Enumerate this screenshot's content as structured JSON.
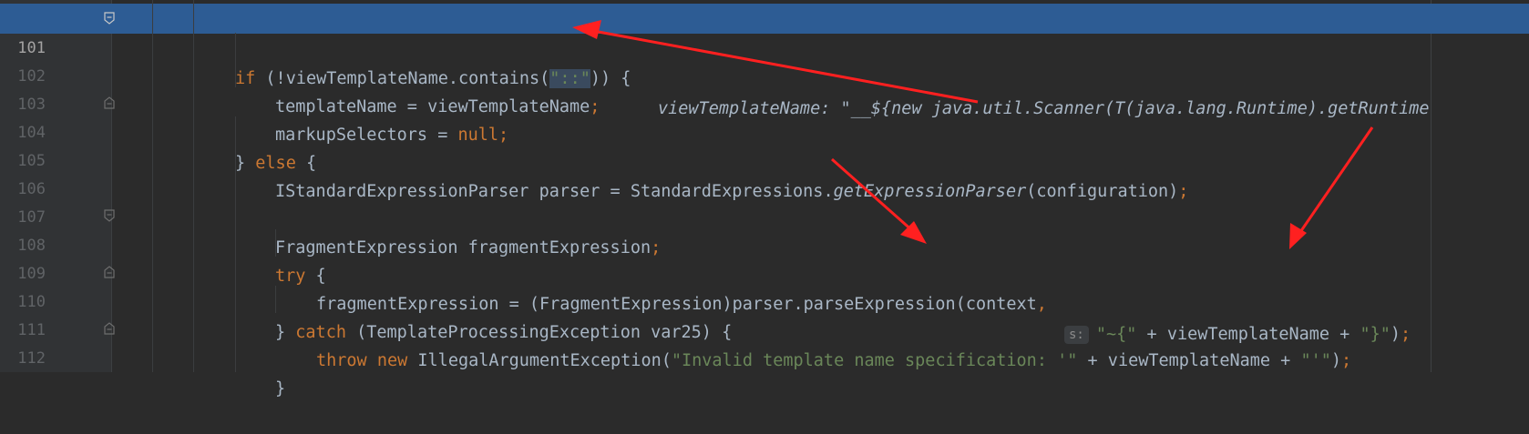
{
  "editor": {
    "lines": [
      {
        "num": "101",
        "current": true
      },
      {
        "num": "102"
      },
      {
        "num": "103"
      },
      {
        "num": "104"
      },
      {
        "num": "105"
      },
      {
        "num": "106"
      },
      {
        "num": "107"
      },
      {
        "num": "108"
      },
      {
        "num": "109"
      },
      {
        "num": "110"
      },
      {
        "num": "111"
      },
      {
        "num": "112"
      }
    ],
    "code": {
      "l101_kw": "if",
      "l101_a": " (!viewTemplateName.contains(",
      "l101_str": "\"::\"",
      "l101_b": ")) {",
      "l101_hint": "viewTemplateName: \"__${new java.util.Scanner(T(java.lang.Runtime).getRuntime",
      "l102_a": "templateName = viewTemplateName",
      "l102_semi": ";",
      "l103_a": "markupSelectors = ",
      "l103_kw": "null",
      "l103_semi": ";",
      "l104_a": "} ",
      "l104_kw": "else",
      "l104_b": " {",
      "l105_a": "IStandardExpressionParser parser = StandardExpressions.",
      "l105_it": "getExpressionParser",
      "l105_b": "(configuration)",
      "l105_semi": ";",
      "l107_a": "FragmentExpression fragmentExpression",
      "l107_semi": ";",
      "l108_kw": "try",
      "l108_b": " {",
      "l109_a": "fragmentExpression = (FragmentExpression)parser.parseExpression(context",
      "l109_comma": ",",
      "l109_hint": "s:",
      "l109_str1": "\"~{\"",
      "l109_b": " + viewTemplateName + ",
      "l109_str2": "\"}\"",
      "l109_c": ")",
      "l109_semi": ";",
      "l110_a": "} ",
      "l110_kw": "catch",
      "l110_b": " (TemplateProcessingException var25) {",
      "l111_kw1": "throw",
      "l111_kw2": "new",
      "l111_a": " IllegalArgumentException(",
      "l111_str1": "\"Invalid template name specification: '\"",
      "l111_b": " + viewTemplateName + ",
      "l111_str2": "\"'\"",
      "l111_c": ")",
      "l111_semi": ";",
      "l112_a": "}"
    }
  },
  "colors": {
    "background": "#2b2b2b",
    "current_line": "#2d5c94",
    "keyword": "#cc7832",
    "string": "#6a8759",
    "default_text": "#a9b7c6",
    "annotation_arrow": "#ff2020"
  }
}
